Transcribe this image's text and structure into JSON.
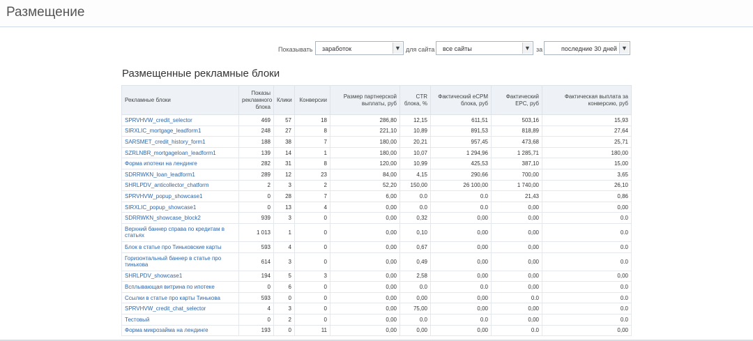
{
  "header": {
    "title": "Размещение"
  },
  "filters": {
    "show_label": "Показывать",
    "show_value": "заработок",
    "site_label": "для сайта",
    "site_value": "все сайты",
    "period_label": "за",
    "period_value": "последние 30 дней"
  },
  "section": {
    "title": "Размещенные рекламные блоки"
  },
  "table": {
    "columns": [
      "Рекламные блоки",
      "Показы рекламного блока",
      "Клики",
      "Конверсии",
      "Размер партнерской выплаты, руб",
      "CTR блока, %",
      "Фактический eCPM блока, руб",
      "Фактический EPC, руб",
      "Фактическая выплата за конверсию, руб"
    ],
    "rows": [
      {
        "name": "SPRVHVW_credit_selector",
        "impressions": "469",
        "clicks": "57",
        "conversions": "18",
        "payout": "286,80",
        "ctr": "12,15",
        "ecpm": "611,51",
        "epc": "503,16",
        "per_conv": "15,93"
      },
      {
        "name": "SIRXLIC_mortgage_leadform1",
        "impressions": "248",
        "clicks": "27",
        "conversions": "8",
        "payout": "221,10",
        "ctr": "10,89",
        "ecpm": "891,53",
        "epc": "818,89",
        "per_conv": "27,64"
      },
      {
        "name": "SARSMET_credit_history_form1",
        "impressions": "188",
        "clicks": "38",
        "conversions": "7",
        "payout": "180,00",
        "ctr": "20,21",
        "ecpm": "957,45",
        "epc": "473,68",
        "per_conv": "25,71"
      },
      {
        "name": "SZRLNBR_mortgageloan_leadform1",
        "impressions": "139",
        "clicks": "14",
        "conversions": "1",
        "payout": "180,00",
        "ctr": "10,07",
        "ecpm": "1 294,96",
        "epc": "1 285,71",
        "per_conv": "180,00"
      },
      {
        "name": "Форма ипотеки на лендинге",
        "impressions": "282",
        "clicks": "31",
        "conversions": "8",
        "payout": "120,00",
        "ctr": "10,99",
        "ecpm": "425,53",
        "epc": "387,10",
        "per_conv": "15,00"
      },
      {
        "name": "SDRRWKN_loan_leadform1",
        "impressions": "289",
        "clicks": "12",
        "conversions": "23",
        "payout": "84,00",
        "ctr": "4,15",
        "ecpm": "290,66",
        "epc": "700,00",
        "per_conv": "3,65"
      },
      {
        "name": "SHRLPDV_anticollector_chatform",
        "impressions": "2",
        "clicks": "3",
        "conversions": "2",
        "payout": "52,20",
        "ctr": "150,00",
        "ecpm": "26 100,00",
        "epc": "1 740,00",
        "per_conv": "26,10"
      },
      {
        "name": "SPRVHVW_popup_showcase1",
        "impressions": "0",
        "clicks": "28",
        "conversions": "7",
        "payout": "6,00",
        "ctr": "0.0",
        "ecpm": "0.0",
        "epc": "21,43",
        "per_conv": "0,86"
      },
      {
        "name": "SIRXLIC_popup_showcase1",
        "impressions": "0",
        "clicks": "13",
        "conversions": "4",
        "payout": "0,00",
        "ctr": "0.0",
        "ecpm": "0.0",
        "epc": "0,00",
        "per_conv": "0,00"
      },
      {
        "name": "SDRRWKN_showcase_block2",
        "impressions": "939",
        "clicks": "3",
        "conversions": "0",
        "payout": "0,00",
        "ctr": "0,32",
        "ecpm": "0,00",
        "epc": "0,00",
        "per_conv": "0.0"
      },
      {
        "name": "Верхний баннер справа по кредитам в статьях",
        "impressions": "1 013",
        "clicks": "1",
        "conversions": "0",
        "payout": "0,00",
        "ctr": "0,10",
        "ecpm": "0,00",
        "epc": "0,00",
        "per_conv": "0.0",
        "tall": true
      },
      {
        "name": "Блок в статье про Тиньковские карты",
        "impressions": "593",
        "clicks": "4",
        "conversions": "0",
        "payout": "0,00",
        "ctr": "0,67",
        "ecpm": "0,00",
        "epc": "0,00",
        "per_conv": "0.0"
      },
      {
        "name": "Горизонтальный баннер в статье про тинькова",
        "impressions": "614",
        "clicks": "3",
        "conversions": "0",
        "payout": "0,00",
        "ctr": "0,49",
        "ecpm": "0,00",
        "epc": "0,00",
        "per_conv": "0.0",
        "tall": true
      },
      {
        "name": "SHRLPDV_showcase1",
        "impressions": "194",
        "clicks": "5",
        "conversions": "3",
        "payout": "0,00",
        "ctr": "2,58",
        "ecpm": "0,00",
        "epc": "0,00",
        "per_conv": "0,00"
      },
      {
        "name": "Всплывающая витрина по ипотеке",
        "impressions": "0",
        "clicks": "6",
        "conversions": "0",
        "payout": "0,00",
        "ctr": "0.0",
        "ecpm": "0.0",
        "epc": "0,00",
        "per_conv": "0.0"
      },
      {
        "name": "Ссылки в статье про карты Тинькова",
        "impressions": "593",
        "clicks": "0",
        "conversions": "0",
        "payout": "0,00",
        "ctr": "0,00",
        "ecpm": "0,00",
        "epc": "0.0",
        "per_conv": "0.0"
      },
      {
        "name": "SPRVHVW_credit_chat_selector",
        "impressions": "4",
        "clicks": "3",
        "conversions": "0",
        "payout": "0,00",
        "ctr": "75,00",
        "ecpm": "0,00",
        "epc": "0,00",
        "per_conv": "0.0"
      },
      {
        "name": "Тестовый",
        "impressions": "0",
        "clicks": "2",
        "conversions": "0",
        "payout": "0,00",
        "ctr": "0.0",
        "ecpm": "0.0",
        "epc": "0,00",
        "per_conv": "0.0"
      },
      {
        "name": "Форма микрозайма на лендинге",
        "impressions": "193",
        "clicks": "0",
        "conversions": "11",
        "payout": "0,00",
        "ctr": "0,00",
        "ecpm": "0,00",
        "epc": "0.0",
        "per_conv": "0,00"
      }
    ]
  }
}
